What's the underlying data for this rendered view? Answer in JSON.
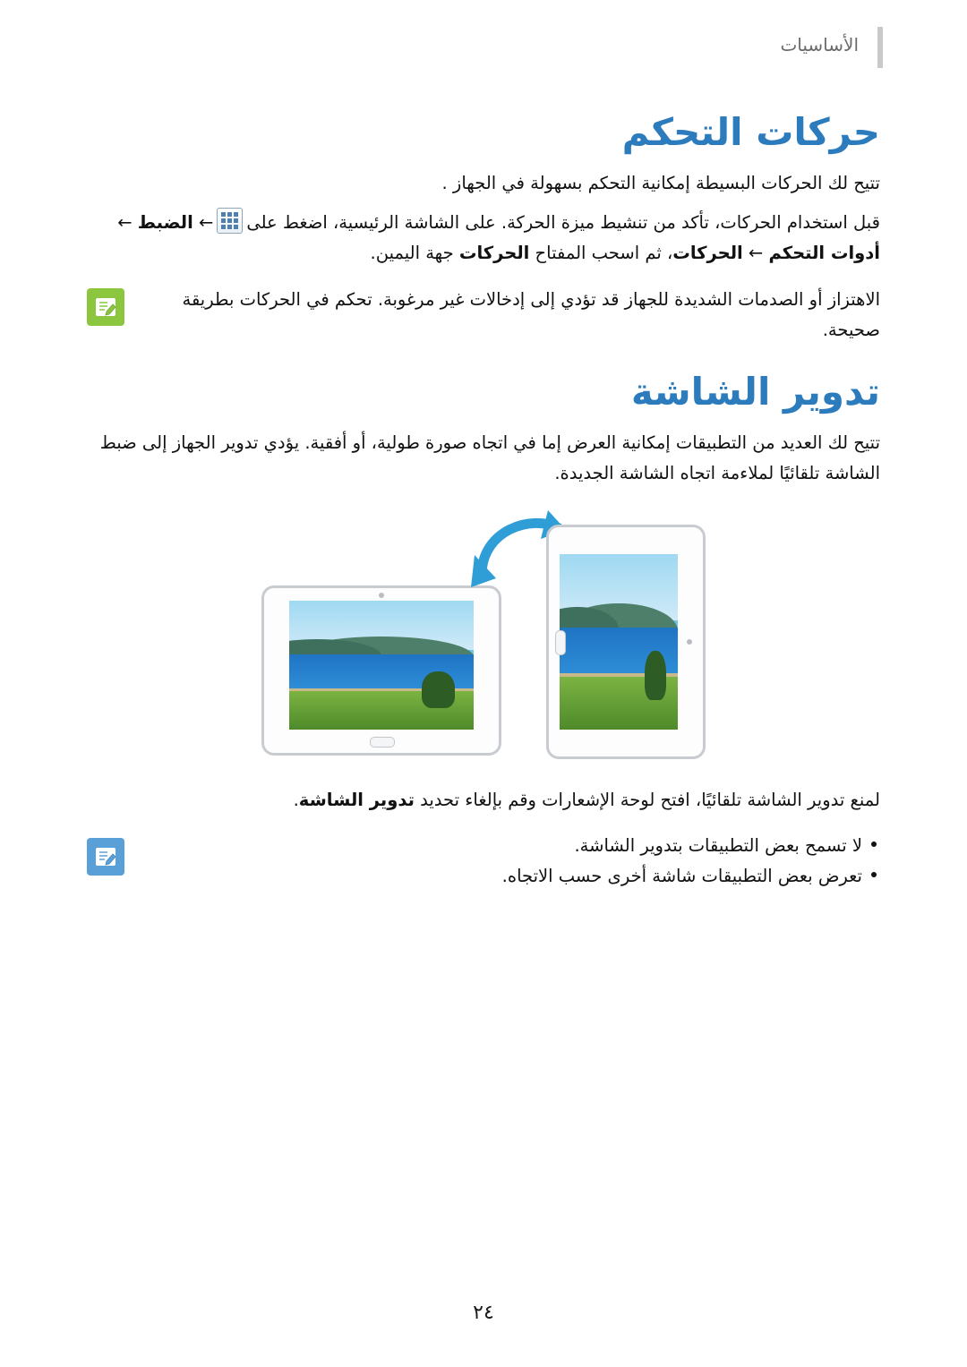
{
  "document": {
    "header_label": "الأساسيات",
    "page_number": "٢٤"
  },
  "sections": [
    {
      "id": "control-motions",
      "heading": "حركات التحكم",
      "paragraph_1": "تتيح لك الحركات البسيطة إمكانية التحكم بسهولة في الجهاز .",
      "paragraph_2_parts": {
        "before_icon": "قبل استخدام الحركات، تأكد من تنشيط ميزة الحركة. على الشاشة الرئيسية، اضغط على",
        "icon": "apps-grid-icon",
        "after_icon": "← الضبط ← أدوات التحكم ← الحركات، ثم اسحب المفتاح الحركات جهة اليمين."
      },
      "paragraph_2_plain": "قبل استخدام الحركات، تأكد من تنشيط ميزة الحركة. على الشاشة الرئيسية، اضغط على ← الضبط ← أدوات التحكم ← الحركات، ثم اسحب المفتاح الحركات جهة اليمين.",
      "note": {
        "icon": "note-pencil-icon",
        "icon_color": "#8cc63f",
        "text": "الاهتزاز أو الصدمات الشديدة للجهاز قد تؤدي إلى إدخالات غير مرغوبة. تحكم في الحركات بطريقة صحيحة."
      }
    },
    {
      "id": "screen-rotation",
      "heading": "تدوير الشاشة",
      "paragraph_1": "تتيح لك العديد من التطبيقات إمكانية العرض إما في اتجاه صورة طولية، أو أفقية. يؤدي تدوير الجهاز إلى ضبط الشاشة تلقائيًا لملاءمة اتجاه الشاشة الجديدة.",
      "illustration": {
        "name": "tablet-rotation-illustration",
        "landscape_device": "tablet-landscape",
        "portrait_device": "tablet-portrait",
        "arrow": "rotate-arrow-icon"
      },
      "bold_line": "لمنع تدوير الشاشة تلقائيًا، افتح لوحة الإشعارات وقم بإلغاء تحديد تدوير الشاشة.",
      "note": {
        "icon": "note-info-icon",
        "icon_color": "#5aa0d8",
        "bullets": [
          "لا تسمح بعض التطبيقات بتدوير الشاشة.",
          "تعرض بعض التطبيقات شاشة أخرى حسب الاتجاه."
        ]
      }
    }
  ]
}
